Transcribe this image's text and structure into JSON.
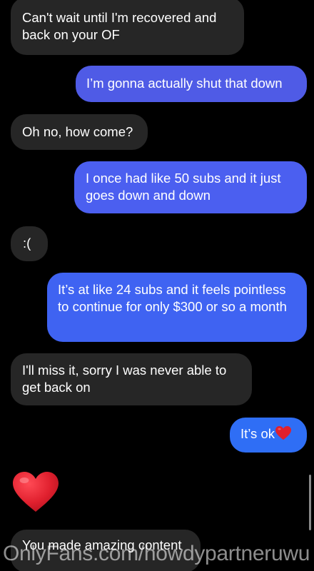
{
  "messages": [
    {
      "id": "m1",
      "sender": "them",
      "text": "Can't wait until I'm recovered and back on your OF"
    },
    {
      "id": "m2",
      "sender": "me",
      "text": "I’m gonna actually shut that down"
    },
    {
      "id": "m3",
      "sender": "them",
      "text": "Oh no, how come?"
    },
    {
      "id": "m4",
      "sender": "me",
      "text": "I once had like 50 subs and it just goes down and down"
    },
    {
      "id": "m5",
      "sender": "them",
      "text": ":("
    },
    {
      "id": "m6",
      "sender": "me",
      "text": "It’s at like 24 subs and it feels pointless to continue for only $300 or so a month"
    },
    {
      "id": "m7",
      "sender": "them",
      "text": "I'll miss it, sorry I was never able to get back on"
    },
    {
      "id": "m8",
      "sender": "me",
      "text": "It’s ok",
      "emoji": "red-heart"
    },
    {
      "id": "m9",
      "sender": "them",
      "emoji": "red-heart"
    },
    {
      "id": "m10",
      "sender": "them",
      "text": "You made amazing content"
    }
  ],
  "watermark": "OnlyFans.com/howdypartneruwu",
  "colors": {
    "background": "#000000",
    "incoming_bubble": "#262626",
    "outgoing_bubble": "#4f5be6",
    "heart": "#e0202e"
  }
}
